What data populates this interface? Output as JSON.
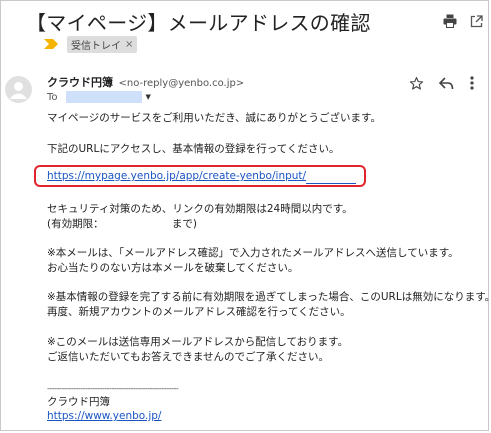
{
  "email": {
    "subject": "【マイページ】メールアドレスの確認",
    "label": "受信トレイ",
    "label_remove": "×",
    "sender_name": "クラウド円簿",
    "sender_address": "<no-reply@yenbo.co.jp>",
    "to_label": "To",
    "body": {
      "line1": "マイページのサービスをご利用いただき、誠にありがとうございます。",
      "line2": "下記のURLにアクセスし、基本情報の登録を行ってください。",
      "link": "https://mypage.yenbo.jp/app/create-yenbo/input/",
      "line3": "セキュリティ対策のため、リンクの有効期限は24時間以内です。",
      "line4": "(有効期限：　　　　　　　まで)",
      "line5": "※本メールは、「メールアドレス確認」で入力されたメールアドレスへ送信しています。",
      "line6": "お心当たりのない方は本メールを破棄してください。",
      "line7": "※基本情報の登録を完了する前に有効期限を過ぎてしまった場合、このURLは無効になります。",
      "line8": "再度、新規アカウントのメールアドレス確認を行ってください。",
      "line9": "※このメールは送信専用メールアドレスから配信しております。",
      "line10": "ご返信いただいてもお答えできませんのでご了承ください。"
    },
    "signature": {
      "separator": "-------------------------------------------------------",
      "name": "クラウド円簿",
      "url": "https://www.yenbo.jp/"
    }
  },
  "icons": {
    "print": "print-icon",
    "popout": "open-in-new-window-icon",
    "important": "importance-marker-icon",
    "avatar": "default-avatar-icon",
    "star": "star-icon",
    "reply": "reply-icon",
    "more": "more-vertical-icon",
    "to_dropdown": "chevron-down-icon"
  },
  "colors": {
    "link": "#1a55c4",
    "highlight_box": "#e0252b",
    "important_marker": "#f4b400",
    "label_bg": "#dddddd",
    "recipient_redaction": "#cfe0fb"
  }
}
